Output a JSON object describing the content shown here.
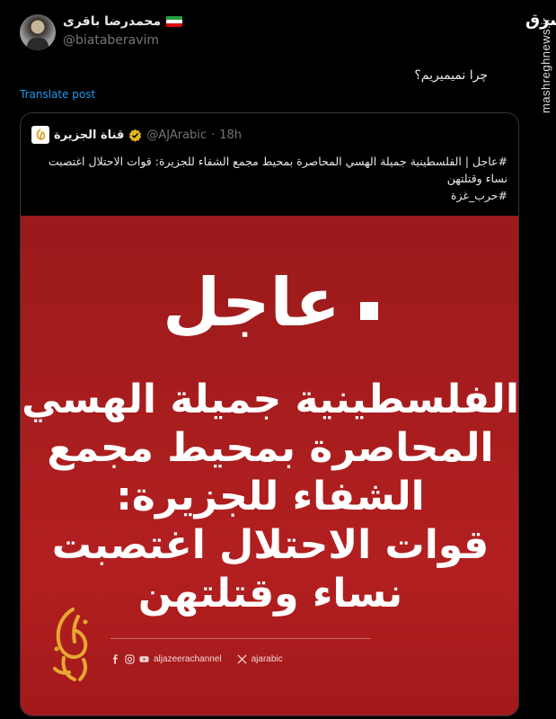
{
  "watermark": {
    "logo_text": "مشرق",
    "site": "mashreghnews.ir"
  },
  "post": {
    "display_name": "محمدرضا باقری",
    "handle": "@biataberavim",
    "text": "چرا نمیمیریم؟",
    "translate_label": "Translate post"
  },
  "quote": {
    "name": "قناة الجزيرة",
    "handle": "@AJArabic",
    "separator": "·",
    "time": "18h",
    "text": "#عاجل | الفلسطينية جميلة الهسي المحاصرة بمحيط مجمع الشفاء للجزيرة: قوات الاحتلال اغتصبت نساء وقتلتهن",
    "hashtag": "#حرب_غزة"
  },
  "media": {
    "urgent": "عاجل",
    "headline_lines": [
      "الفلسطينية جميلة الهسي",
      "المحاصرة بمحيط مجمع",
      "الشفاء للجزيرة:",
      "قوات الاحتلال اغتصبت",
      "نساء وقتلتهن"
    ],
    "channel": "aljazeerachannel",
    "x_handle": "ajarabic"
  },
  "colors": {
    "background": "#000000",
    "link": "#1d9bf0",
    "card_red": "#a81d1e",
    "gold": "#d9a22b"
  }
}
